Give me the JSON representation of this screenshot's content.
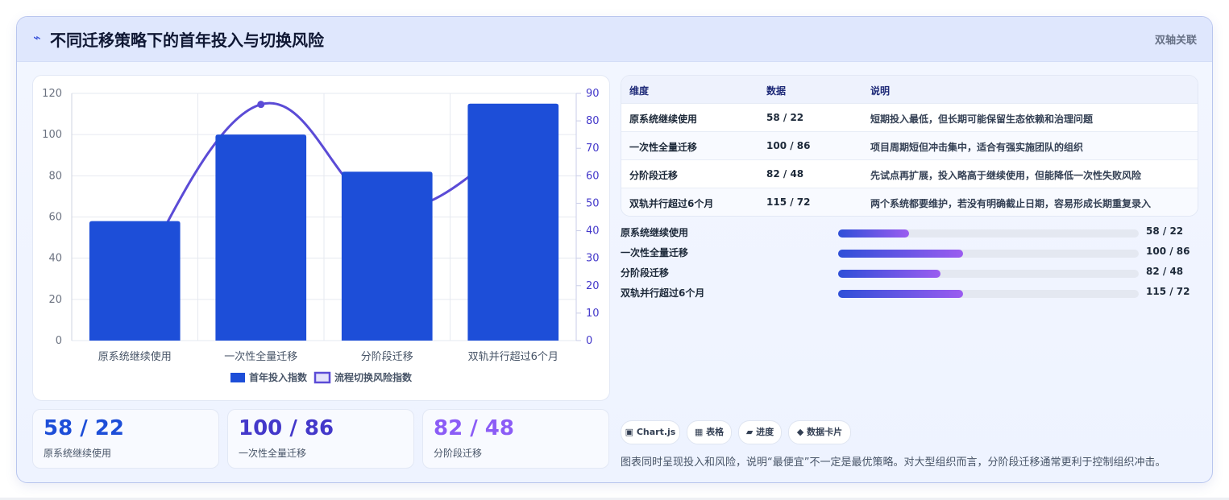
{
  "header": {
    "icon": "⌁",
    "title": "不同迁移策略下的首年投入与切换风险",
    "tag": "双轴关联"
  },
  "chart_data": {
    "type": "bar",
    "categories": [
      "原系统继续使用",
      "一次性全量迁移",
      "分阶段迁移",
      "双轨并行超过6个月"
    ],
    "series": [
      {
        "name": "首年投入指数",
        "type": "bar",
        "axis": "left",
        "values": [
          58,
          100,
          82,
          115
        ],
        "color": "#1d4ed8"
      },
      {
        "name": "流程切换风险指数",
        "type": "line",
        "axis": "right",
        "values": [
          22,
          86,
          48,
          72
        ],
        "color": "#5b4bd6"
      }
    ],
    "y_left": {
      "min": 0,
      "max": 120,
      "ticks": [
        0,
        20,
        40,
        60,
        80,
        100,
        120
      ]
    },
    "y_right": {
      "min": 0,
      "max": 90,
      "ticks": [
        0,
        10,
        20,
        30,
        40,
        50,
        60,
        70,
        80,
        90
      ]
    },
    "grid": true,
    "legend": "bottom-center"
  },
  "kpis": [
    {
      "value": "58 / 22",
      "label": "原系统继续使用",
      "color": "#1d4ed8"
    },
    {
      "value": "100 / 86",
      "label": "一次性全量迁移",
      "color": "#4338ca"
    },
    {
      "value": "82 / 48",
      "label": "分阶段迁移",
      "color": "#8b5cf6"
    }
  ],
  "table": {
    "headers": [
      "维度",
      "数据",
      "说明"
    ],
    "rows": [
      [
        "原系统继续使用",
        "58 / 22",
        "短期投入最低，但长期可能保留生态依赖和治理问题"
      ],
      [
        "一次性全量迁移",
        "100 / 86",
        "项目周期短但冲击集中，适合有强实施团队的组织"
      ],
      [
        "分阶段迁移",
        "82 / 48",
        "先试点再扩展，投入略高于继续使用，但能降低一次性失败风险"
      ],
      [
        "双轨并行超过6个月",
        "115 / 72",
        "两个系统都要维护，若没有明确截止日期，容易形成长期重复录入"
      ]
    ]
  },
  "progress": [
    {
      "label": "原系统继续使用",
      "value_text": "58 / 22",
      "fraction": 0.236
    },
    {
      "label": "一次性全量迁移",
      "value_text": "100 / 86",
      "fraction": 0.415
    },
    {
      "label": "分阶段迁移",
      "value_text": "82 / 48",
      "fraction": 0.34
    },
    {
      "label": "双轨并行超过6个月",
      "value_text": "115 / 72",
      "fraction": 0.415
    }
  ],
  "chips": [
    "▣ Chart.js",
    "▦ 表格",
    "▰ 进度",
    "◆ 数据卡片"
  ],
  "note": "图表同时呈现投入和风险，说明“最便宜”不一定是最优策略。对大型组织而言，分阶段迁移通常更利于控制组织冲击。"
}
